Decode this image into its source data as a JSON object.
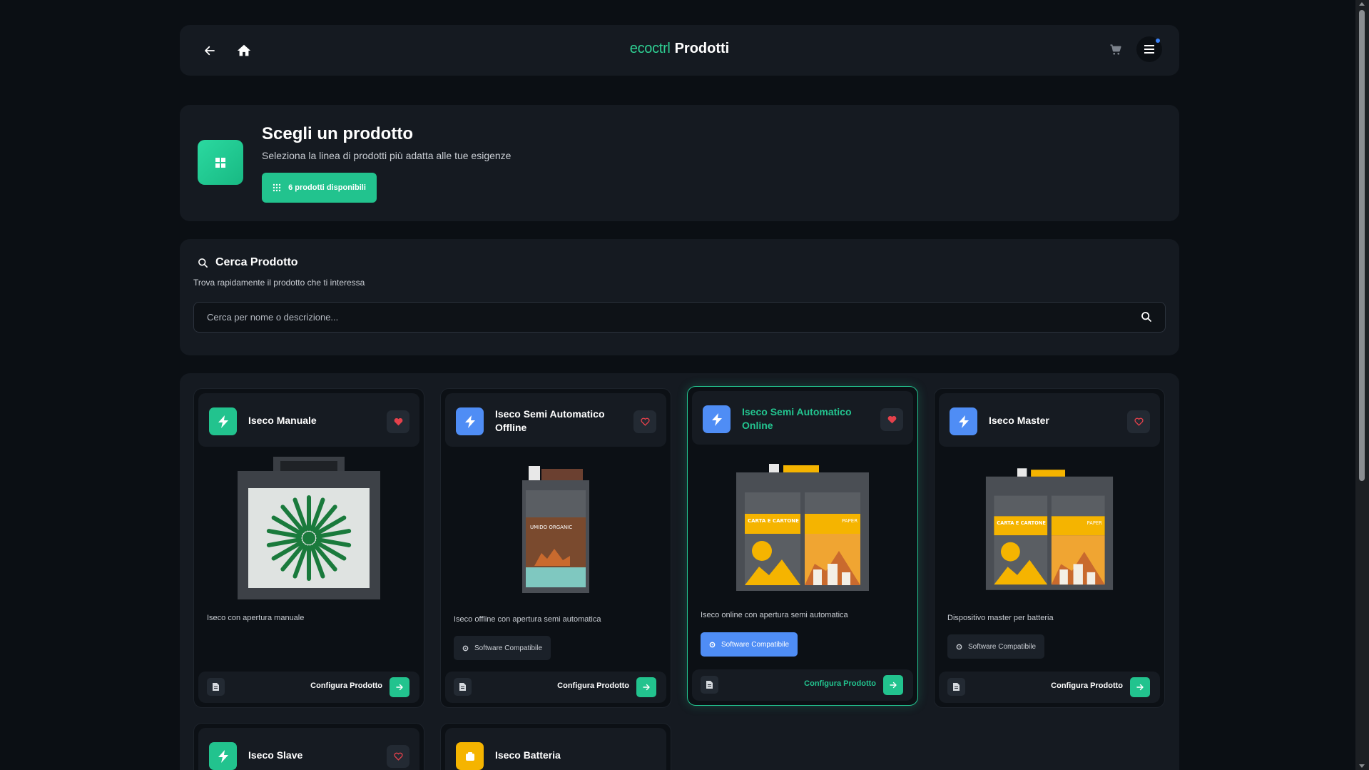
{
  "header": {
    "logo": "ecoctrl",
    "title": "Prodotti"
  },
  "hero": {
    "title": "Scegli un prodotto",
    "subtitle": "Seleziona la linea di prodotti più adatta alle tue esigenze",
    "badge": "6 prodotti disponibili"
  },
  "search": {
    "title": "Cerca Prodotto",
    "description": "Trova rapidamente il prodotto che ti interessa",
    "placeholder": "Cerca per nome o descrizione..."
  },
  "colors": {
    "accent": "#22c38e",
    "blue": "#4f8df5",
    "yellow": "#f5b400",
    "heart": "#e5414b"
  },
  "products": [
    {
      "name": "Iseco Manuale",
      "description": "Iseco con apertura manuale",
      "icon": "bolt-icon",
      "favorite": true,
      "chip": "",
      "configure": "Configura Prodotto"
    },
    {
      "name": "Iseco Semi Automatico Offline",
      "description": "Iseco offline con apertura semi automatica",
      "icon": "bolt-icon",
      "favorite": false,
      "chip": "Software Compatibile",
      "configure": "Configura Prodotto"
    },
    {
      "name": "Iseco Semi Automatico Online",
      "description": "Iseco online con apertura semi automatica",
      "icon": "bolt-icon",
      "favorite": true,
      "chip": "Software Compatibile",
      "configure": "Configura Prodotto",
      "selected": true
    },
    {
      "name": "Iseco Master",
      "description": "Dispositivo master per batteria",
      "icon": "bolt-icon",
      "favorite": false,
      "chip": "Software Compatibile",
      "configure": "Configura Prodotto"
    },
    {
      "name": "Iseco Slave",
      "icon": "bolt-icon",
      "favorite": false
    },
    {
      "name": "Iseco Batteria",
      "icon": "battery-icon"
    }
  ],
  "image_labels": {
    "carta": "CARTA E CARTONE",
    "paper": "PAPER",
    "umido": "UMIDO ORGANIC"
  }
}
